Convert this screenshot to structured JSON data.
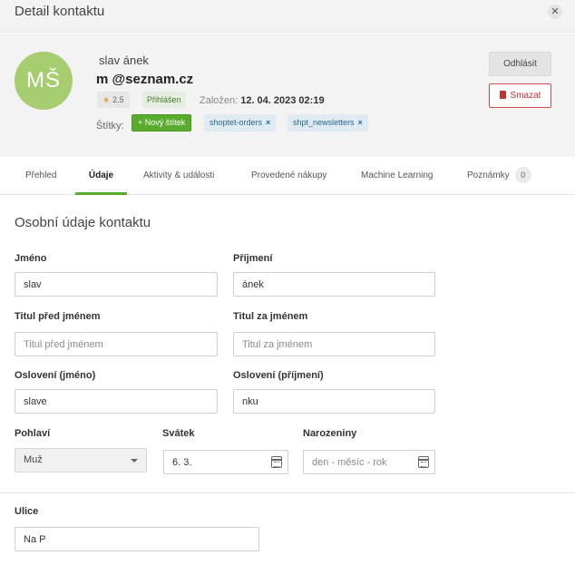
{
  "modal": {
    "title": "Detail kontaktu",
    "close_glyph": "✕"
  },
  "contact": {
    "initials": "MŠ",
    "name": "slav        ánek",
    "email": "m                   @seznam.cz",
    "rating": "2.5",
    "status": "Přihlášen",
    "created_label": "Založen:",
    "created_value": "12. 04. 2023 02:19",
    "tags_label": "Štítky:",
    "new_tag_label": "+ Nový štítek",
    "tags": [
      {
        "label": "shoptet-orders",
        "remove": "×"
      },
      {
        "label": "shpt_newsletters",
        "remove": "×"
      }
    ],
    "logout_label": "Odhlásit",
    "delete_label": "Smazat"
  },
  "tabs": [
    {
      "label": "Přehled"
    },
    {
      "label": "Údaje"
    },
    {
      "label": "Aktivity & události"
    },
    {
      "label": "Provedené nákupy"
    },
    {
      "label": "Machine Learning"
    },
    {
      "label": "Poznámky",
      "count": "0"
    }
  ],
  "form": {
    "section_title": "Osobní údaje kontaktu",
    "first_name": {
      "label": "Jméno",
      "value": "slav"
    },
    "last_name": {
      "label": "Příjmení",
      "value": "ánek"
    },
    "title_before": {
      "label": "Titul před jménem",
      "placeholder": "Titul před jménem"
    },
    "title_after": {
      "label": "Titul za jménem",
      "placeholder": "Titul za jménem"
    },
    "salutation_first": {
      "label": "Oslovení (jméno)",
      "value": "slave"
    },
    "salutation_last": {
      "label": "Oslovení (příjmení)",
      "value": "nku"
    },
    "gender": {
      "label": "Pohlaví",
      "value": "Muž"
    },
    "name_day": {
      "label": "Svátek",
      "value": "6. 3."
    },
    "birthday": {
      "label": "Narozeniny",
      "placeholder": "den - měsíc - rok"
    },
    "street": {
      "label": "Ulice",
      "value": "Na P"
    }
  }
}
